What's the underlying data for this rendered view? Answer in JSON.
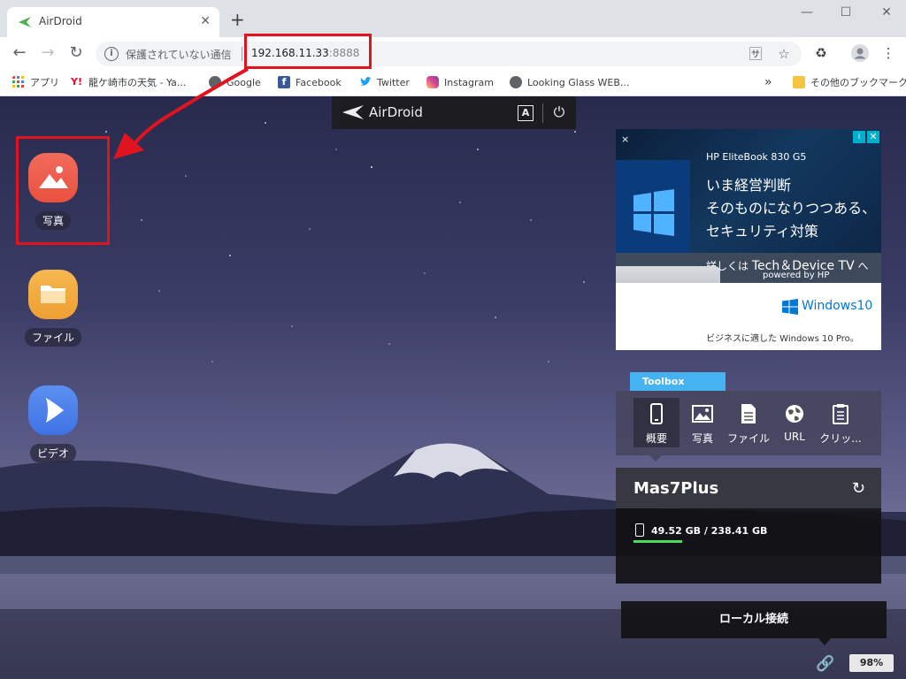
{
  "browser": {
    "tab_title": "AirDroid",
    "address": {
      "security_label": "保護されていない通信",
      "host": "192.168.11.33",
      "port": ":8888"
    },
    "bookmarks": [
      {
        "label": "アプリ",
        "icon": "apps-grid-icon"
      },
      {
        "label": "龍ケ崎市の天気 - Ya...",
        "icon": "yahoo-icon"
      },
      {
        "label": "Google",
        "icon": "globe-icon"
      },
      {
        "label": "Facebook",
        "icon": "facebook-icon"
      },
      {
        "label": "Twitter",
        "icon": "twitter-icon"
      },
      {
        "label": "Instagram",
        "icon": "instagram-icon"
      },
      {
        "label": "Looking Glass WEB...",
        "icon": "globe-icon"
      }
    ],
    "other_bookmarks": "その他のブックマーク",
    "more": "»"
  },
  "airdroid": {
    "brand": "AirDroid",
    "lang_button": "A",
    "apps": [
      {
        "label": "写真",
        "icon": "photo-icon"
      },
      {
        "label": "ファイル",
        "icon": "folder-icon"
      },
      {
        "label": "ビデオ",
        "icon": "video-play-icon"
      }
    ],
    "ad": {
      "product": "HP EliteBook 830 G5",
      "line1": "いま経営判断",
      "line2": "そのものになりつつある、",
      "line3": "セキュリティ対策",
      "cta_prefix": "詳しくは",
      "cta_brand": "Tech＆Device TV",
      "cta_suffix": "へ",
      "powered": "powered by HP",
      "windows": "Windows10",
      "tagline": "ビジネスに適した Windows 10 Pro。",
      "close": "×"
    },
    "toolbox": {
      "title": "Toolbox",
      "tools": [
        {
          "label": "概要",
          "icon": "phone-icon"
        },
        {
          "label": "写真",
          "icon": "image-icon"
        },
        {
          "label": "ファイル",
          "icon": "document-icon"
        },
        {
          "label": "URL",
          "icon": "globe-url-icon"
        },
        {
          "label": "クリッ...",
          "icon": "clipboard-icon"
        }
      ]
    },
    "device": {
      "name": "Mas7Plus",
      "storage": "49.52 GB / 238.41 GB",
      "storage_used_fraction": 0.21
    },
    "connection": "ローカル接続",
    "battery": "98%"
  }
}
